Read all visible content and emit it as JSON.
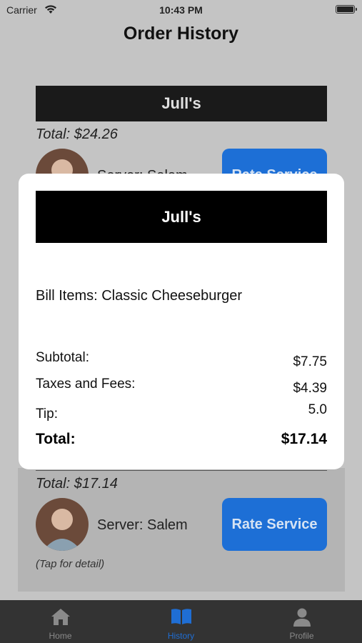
{
  "status_bar": {
    "carrier": "Carrier",
    "time": "10:43 PM"
  },
  "page_title": "Order History",
  "orders": [
    {
      "restaurant": "Jull's",
      "total": "Total: $24.26",
      "server": "Server: Salem",
      "rate_label": "Rate Service"
    },
    {
      "total": "Total: $17.14",
      "server": "Server: Salem",
      "rate_label": "Rate Service",
      "hint": "(Tap for detail)"
    }
  ],
  "modal": {
    "restaurant": "Jull's",
    "bill_items": "Bill Items: Classic Cheeseburger",
    "subtotal_label": "Subtotal:",
    "subtotal_value": "$7.75",
    "taxes_label": "Taxes and Fees:",
    "taxes_value": "$4.39",
    "tip_label": "Tip:",
    "tip_value": "5.0",
    "total_label": "Total:",
    "total_value": "$17.14"
  },
  "tabs": [
    {
      "label": "Home",
      "icon": "home-icon",
      "active": false
    },
    {
      "label": "History",
      "icon": "book-icon",
      "active": true
    },
    {
      "label": "Profile",
      "icon": "person-icon",
      "active": false
    }
  ],
  "colors": {
    "accent": "#1f6ed4",
    "button": "#1d6fd6",
    "tab_bar": "#333333",
    "overlay_bg": "#c4c4c4"
  }
}
